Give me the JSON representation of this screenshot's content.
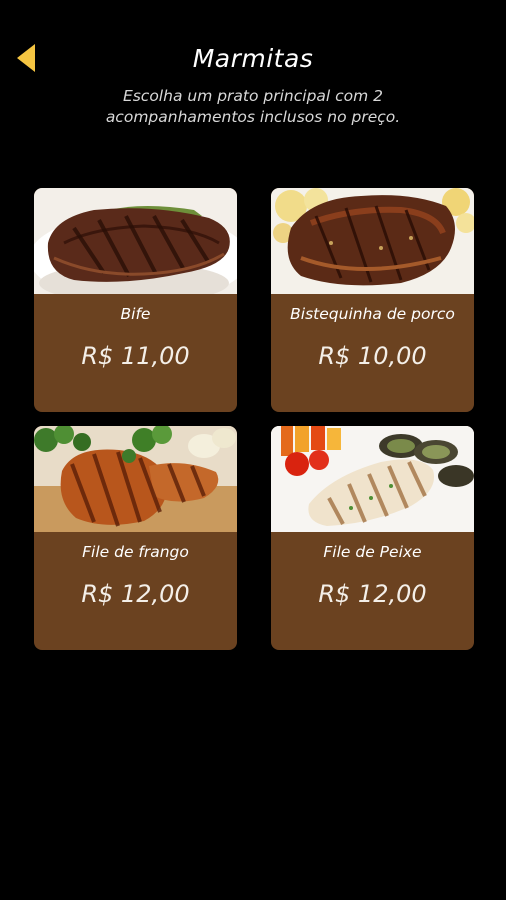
{
  "header": {
    "back_icon": "back-arrow-icon",
    "title": "Marmitas",
    "subtitle_line1": "Escolha um prato principal com 2",
    "subtitle_line2": "acompanhamentos inclusos no preço."
  },
  "colors": {
    "background": "#000000",
    "card": "#6b4220",
    "accent": "#f5c542"
  },
  "items": [
    {
      "name": "Bife",
      "price": "R$ 11,00",
      "photo": "steak-photo"
    },
    {
      "name": "Bistequinha de porco",
      "price": "R$ 10,00",
      "photo": "pork-chop-photo"
    },
    {
      "name": "File de frango",
      "price": "R$ 12,00",
      "photo": "grilled-chicken-photo"
    },
    {
      "name": "File de Peixe",
      "price": "R$ 12,00",
      "photo": "grilled-fish-photo"
    }
  ]
}
